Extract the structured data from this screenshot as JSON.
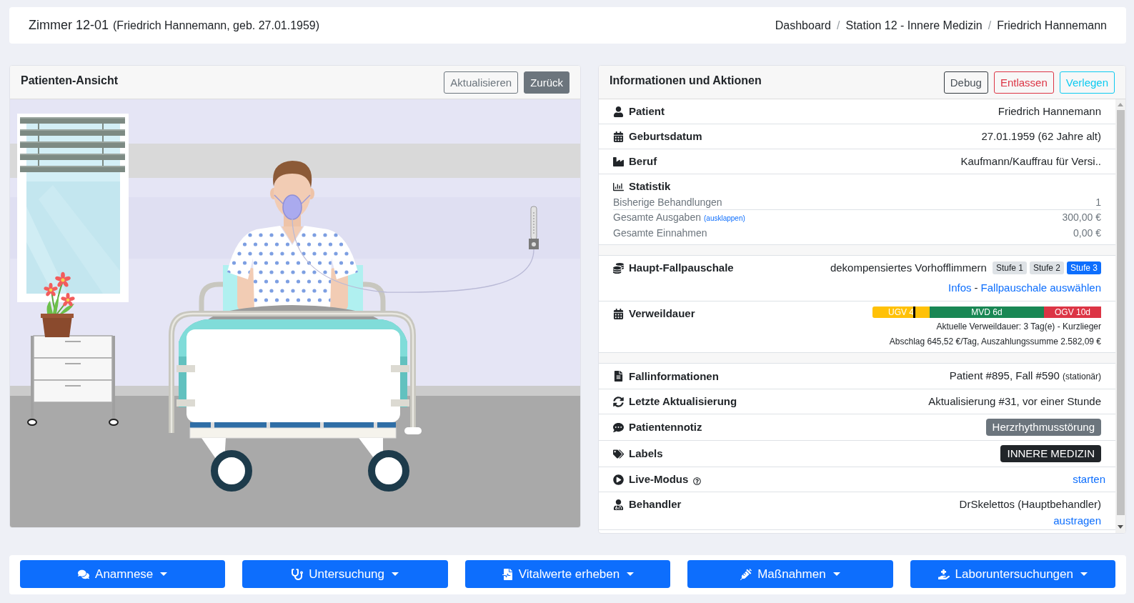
{
  "header": {
    "room": "Zimmer 12-01",
    "subtitle": "(Friedrich Hannemann, geb. 27.01.1959)",
    "breadcrumb": [
      {
        "kind": "link",
        "label": "Dashboard"
      },
      {
        "kind": "separator",
        "label": "/"
      },
      {
        "kind": "link",
        "label": "Station 12 - Innere Medizin"
      },
      {
        "kind": "separator",
        "label": "/"
      },
      {
        "kind": "current",
        "label": "Friedrich Hannemann"
      }
    ]
  },
  "patient_view": {
    "title": "Patienten-Ansicht",
    "buttons": [
      {
        "label": "Aktualisieren"
      },
      {
        "label": "Zurück"
      }
    ]
  },
  "info_panel": {
    "title": "Informationen und Aktionen",
    "buttons": [
      {
        "label": "Debug"
      },
      {
        "label": "Entlassen"
      },
      {
        "label": "Verlegen"
      }
    ],
    "groups": [
      {
        "rows": [
          {
            "kind": "text",
            "label": "Patient",
            "value": "Friedrich Hannemann"
          },
          {
            "kind": "text",
            "label": "Geburtsdatum",
            "value": "27.01.1959 (62 Jahre alt)"
          },
          {
            "kind": "text",
            "label": "Beruf",
            "value": "Kaufmann/Kauffrau für Versi.."
          },
          {
            "kind": "stats",
            "label": "Statistik",
            "items": [
              {
                "label": "Bisherige Behandlungen",
                "value": "1"
              },
              {
                "label": "Gesamte Ausgaben",
                "link": "(ausklappen)",
                "value": "300,00 €"
              },
              {
                "label": "Gesamte Einnahmen",
                "value": "0,00 €"
              }
            ]
          }
        ]
      },
      {
        "rows": [
          {
            "kind": "flat_rate",
            "label": "Haupt-Fallpauschale",
            "value": "dekompensiertes Vorhofflimmern",
            "levels": [
              {
                "label": "Stufe 1",
                "selected": false
              },
              {
                "label": "Stufe 2",
                "selected": false
              },
              {
                "label": "Stufe 3",
                "selected": true
              }
            ],
            "links": [
              {
                "kind": "link",
                "label": "Infos"
              },
              {
                "kind": "separator",
                "label": "-"
              },
              {
                "kind": "link",
                "label": "Fallpauschale auswählen"
              }
            ]
          },
          {
            "kind": "stay",
            "label": "Verweildauer",
            "bar": {
              "level": 0.18,
              "segments": [
                {
                  "kind": "lower",
                  "label": "UGV 4",
                  "color": "#ffc107"
                },
                {
                  "kind": "mean",
                  "label": "MVD 6d",
                  "color": "#198754"
                },
                {
                  "kind": "upper",
                  "label": "OGV 10d",
                  "color": "#dc3545"
                }
              ]
            },
            "notes": [
              "Aktuelle Verweildauer: 3 Tag(e) - Kurzlieger",
              "Abschlag 645,52 €/Tag, Auszahlungssumme 2.582,09 €"
            ]
          }
        ]
      },
      {
        "rows": [
          {
            "kind": "text",
            "label": "Fallinformationen",
            "value": "Patient #895, Fall #590",
            "note": "(stationär)"
          },
          {
            "kind": "text",
            "label": "Letzte Aktualisierung",
            "value": "Aktualisierung #31, vor einer Stunde"
          },
          {
            "kind": "note",
            "label": "Patientennotiz",
            "value": "Herzrhythmusstörung"
          },
          {
            "kind": "tag",
            "label": "Labels",
            "value": "INNERE MEDIZIN"
          },
          {
            "kind": "link",
            "label": "Live-Modus",
            "help": true,
            "value": "starten"
          },
          {
            "kind": "person",
            "label": "Behandler",
            "value": "DrSkelettos (Hauptbehandler)",
            "action": "austragen"
          }
        ]
      }
    ]
  },
  "actions": [
    {
      "label": "Anamnese",
      "dropdown": true
    },
    {
      "label": "Untersuchung",
      "dropdown": true
    },
    {
      "label": "Vitalwerte erheben",
      "dropdown": true
    },
    {
      "label": "Maßnahmen",
      "dropdown": true
    },
    {
      "label": "Laboruntersuchungen",
      "dropdown": true
    }
  ]
}
